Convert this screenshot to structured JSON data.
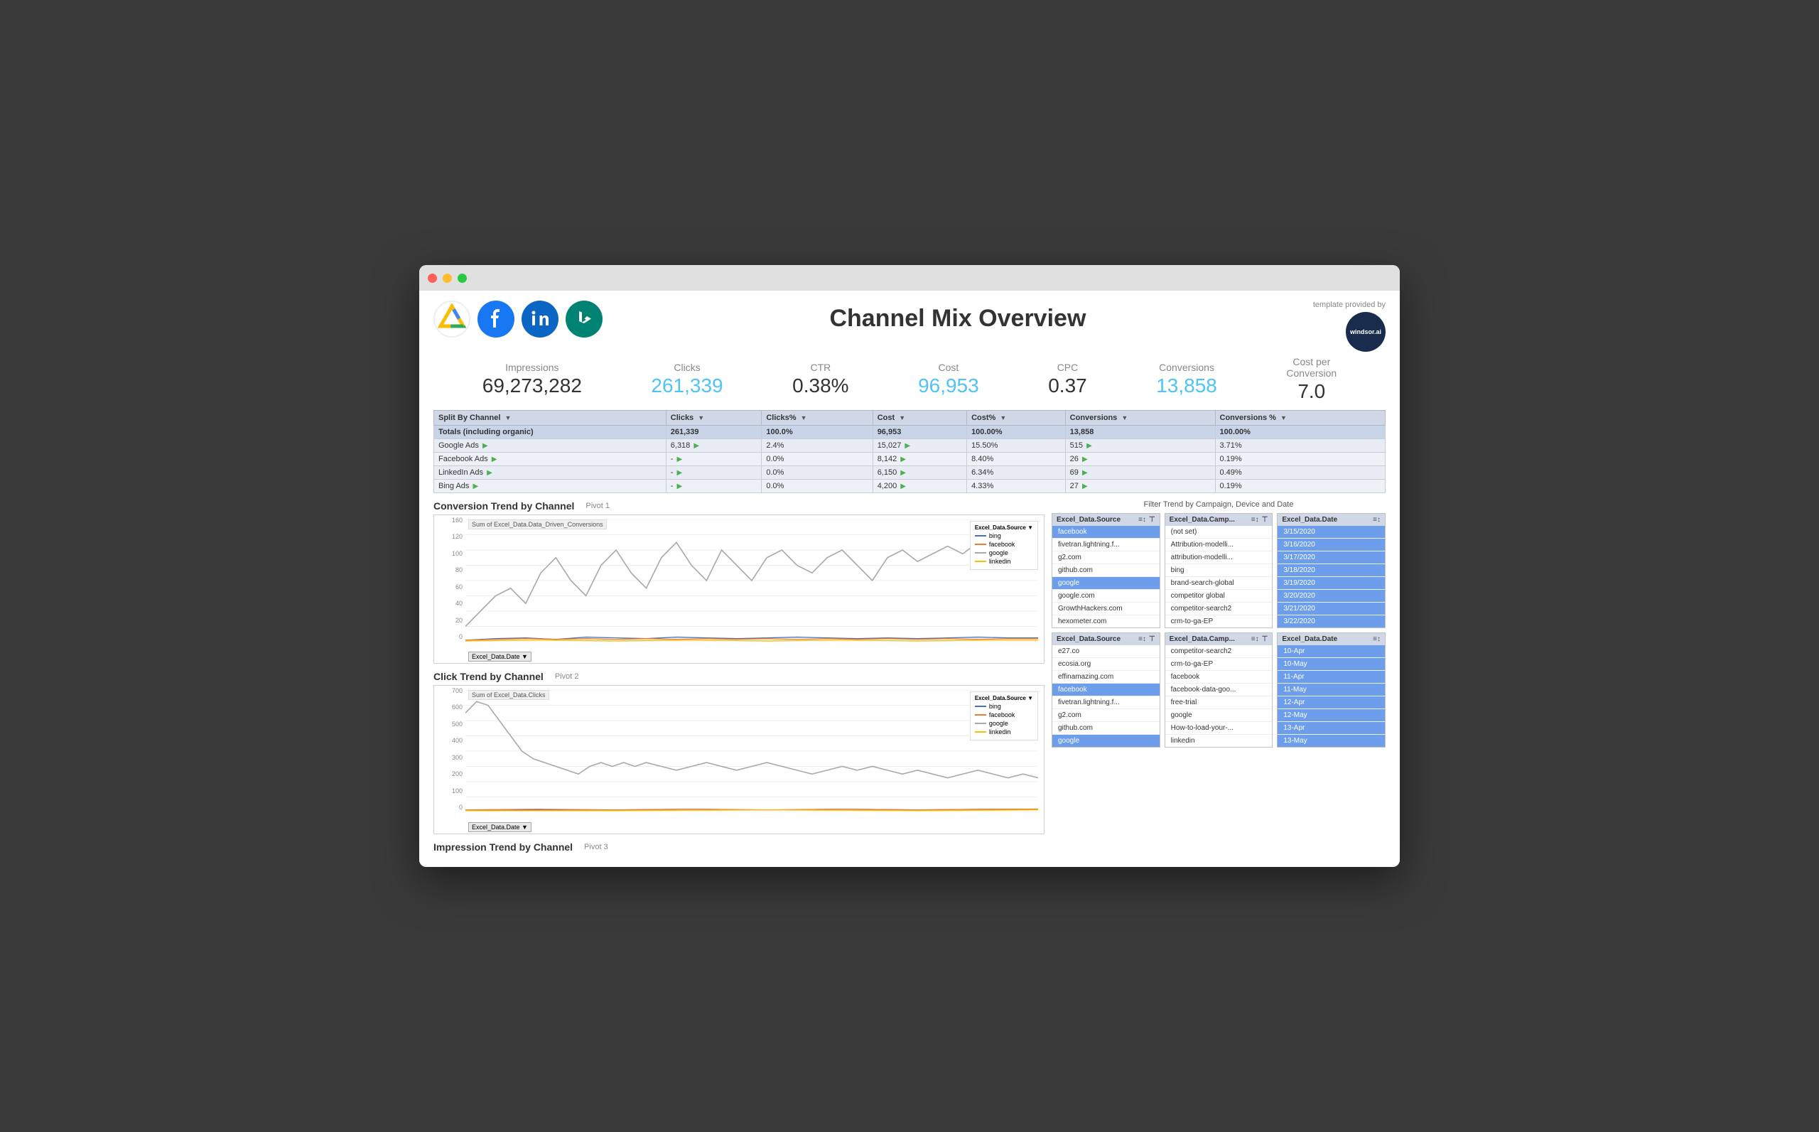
{
  "window": {
    "title": "Channel Mix Overview"
  },
  "header": {
    "template_text": "template provided by",
    "windsor_label": "windsor.ai",
    "page_title": "Channel Mix Overview"
  },
  "metrics": [
    {
      "label": "Impressions",
      "value": "69,273,282",
      "highlight": false
    },
    {
      "label": "Clicks",
      "value": "261,339",
      "highlight": true
    },
    {
      "label": "CTR",
      "value": "0.38%",
      "highlight": false
    },
    {
      "label": "Cost",
      "value": "96,953",
      "highlight": true
    },
    {
      "label": "CPC",
      "value": "0.37",
      "highlight": false
    },
    {
      "label": "Conversions",
      "value": "13,858",
      "highlight": true
    },
    {
      "label": "Cost per\nConversion",
      "value": "7.0",
      "highlight": false
    }
  ],
  "table": {
    "headers": [
      "Split By Channel",
      "Clicks",
      "Clicks%",
      "Cost",
      "Cost%",
      "Conversions",
      "Conversions %"
    ],
    "rows": [
      {
        "channel": "Totals (including organic)",
        "clicks": "261,339",
        "clicks_pct": "100.0%",
        "cost": "96,953",
        "cost_pct": "100.00%",
        "conversions": "13,858",
        "conv_pct": "100.00%",
        "is_total": true
      },
      {
        "channel": "Google Ads",
        "clicks": "6,318",
        "clicks_pct": "2.4%",
        "cost": "15,027",
        "cost_pct": "15.50%",
        "conversions": "515",
        "conv_pct": "3.71%",
        "is_total": false
      },
      {
        "channel": "Facebook Ads",
        "clicks": "-",
        "clicks_pct": "0.0%",
        "cost": "8,142",
        "cost_pct": "8.40%",
        "conversions": "26",
        "conv_pct": "0.19%",
        "is_total": false
      },
      {
        "channel": "LinkedIn Ads",
        "clicks": "-",
        "clicks_pct": "0.0%",
        "cost": "6,150",
        "cost_pct": "6.34%",
        "conversions": "69",
        "conv_pct": "0.49%",
        "is_total": false
      },
      {
        "channel": "Bing Ads",
        "clicks": "-",
        "clicks_pct": "0.0%",
        "cost": "4,200",
        "cost_pct": "4.33%",
        "conversions": "27",
        "conv_pct": "0.19%",
        "is_total": false
      }
    ]
  },
  "chart1": {
    "title": "Conversion Trend by Channel",
    "pivot": "Pivot 1",
    "data_label": "Sum of Excel_Data.Data_Driven_Conversions",
    "y_axis": [
      "160",
      "120",
      "100",
      "80",
      "60",
      "40",
      "20",
      "0"
    ],
    "date_filter": "Excel_Data.Date",
    "legend": [
      {
        "label": "bing",
        "color": "#4472c4"
      },
      {
        "label": "facebook",
        "color": "#ed7d31"
      },
      {
        "label": "google",
        "color": "#a9a9a9"
      },
      {
        "label": "linkedin",
        "color": "#ffc000"
      }
    ]
  },
  "chart2": {
    "title": "Click Trend by Channel",
    "pivot": "Pivot 2",
    "data_label": "Sum of Excel_Data.Clicks",
    "y_axis": [
      "700",
      "600",
      "500",
      "400",
      "300",
      "200",
      "100",
      "0"
    ],
    "date_filter": "Excel_Data.Date",
    "legend": [
      {
        "label": "bing",
        "color": "#4472c4"
      },
      {
        "label": "facebook",
        "color": "#ed7d31"
      },
      {
        "label": "google",
        "color": "#a9a9a9"
      },
      {
        "label": "linkedin",
        "color": "#ffc000"
      }
    ]
  },
  "chart3": {
    "title": "Impression Trend by Channel",
    "pivot": "Pivot 3"
  },
  "filter_title": "Filter Trend by Campaign, Device and Date",
  "filter_panels_top": [
    {
      "id": "source1",
      "header": "Excel_Data.Source",
      "items": [
        {
          "label": "facebook",
          "selected": true
        },
        {
          "label": "fivetran.lightning.f...",
          "selected": false
        },
        {
          "label": "g2.com",
          "selected": false
        },
        {
          "label": "github.com",
          "selected": false
        },
        {
          "label": "google",
          "selected": true
        },
        {
          "label": "google.com",
          "selected": false
        },
        {
          "label": "GrowthHackers.com",
          "selected": false
        },
        {
          "label": "hexometer.com",
          "selected": false
        }
      ]
    },
    {
      "id": "camp1",
      "header": "Excel_Data.Camp...",
      "items": [
        {
          "label": "(not set)",
          "selected": false
        },
        {
          "label": "Attribution-modelli...",
          "selected": false
        },
        {
          "label": "attribution-modelli...",
          "selected": false
        },
        {
          "label": "bing",
          "selected": false
        },
        {
          "label": "brand-search-global",
          "selected": false
        },
        {
          "label": "competitor global",
          "selected": false
        },
        {
          "label": "competitor-search2",
          "selected": false
        },
        {
          "label": "crm-to-ga-EP",
          "selected": false
        }
      ]
    },
    {
      "id": "date1",
      "header": "Excel_Data.Date",
      "items": [
        {
          "label": "3/15/2020",
          "selected": true
        },
        {
          "label": "3/16/2020",
          "selected": true
        },
        {
          "label": "3/17/2020",
          "selected": true
        },
        {
          "label": "3/18/2020",
          "selected": true
        },
        {
          "label": "3/19/2020",
          "selected": true
        },
        {
          "label": "3/20/2020",
          "selected": true
        },
        {
          "label": "3/21/2020",
          "selected": true
        },
        {
          "label": "3/22/2020",
          "selected": true
        }
      ]
    }
  ],
  "filter_panels_bottom": [
    {
      "id": "source2",
      "header": "Excel_Data.Source",
      "items": [
        {
          "label": "e27.co",
          "selected": false
        },
        {
          "label": "ecosia.org",
          "selected": false
        },
        {
          "label": "effinamazing.com",
          "selected": false
        },
        {
          "label": "facebook",
          "selected": true
        },
        {
          "label": "fivetran.lightning.f...",
          "selected": false
        },
        {
          "label": "g2.com",
          "selected": false
        },
        {
          "label": "github.com",
          "selected": false
        },
        {
          "label": "google",
          "selected": true
        }
      ]
    },
    {
      "id": "camp2",
      "header": "Excel_Data.Camp...",
      "items": [
        {
          "label": "competitor-search2",
          "selected": false
        },
        {
          "label": "crm-to-ga-EP",
          "selected": false
        },
        {
          "label": "facebook",
          "selected": false
        },
        {
          "label": "facebook-data-goo...",
          "selected": false
        },
        {
          "label": "free-trial",
          "selected": false
        },
        {
          "label": "google",
          "selected": false
        },
        {
          "label": "How-to-load-your-...",
          "selected": false
        },
        {
          "label": "linkedin",
          "selected": false
        }
      ]
    },
    {
      "id": "date2",
      "header": "Excel_Data.Date",
      "items": [
        {
          "label": "10-Apr",
          "selected": true
        },
        {
          "label": "10-May",
          "selected": true
        },
        {
          "label": "11-Apr",
          "selected": true
        },
        {
          "label": "11-May",
          "selected": true
        },
        {
          "label": "12-Apr",
          "selected": true
        },
        {
          "label": "12-May",
          "selected": true
        },
        {
          "label": "13-Apr",
          "selected": true
        },
        {
          "label": "13-May",
          "selected": true
        }
      ]
    }
  ]
}
